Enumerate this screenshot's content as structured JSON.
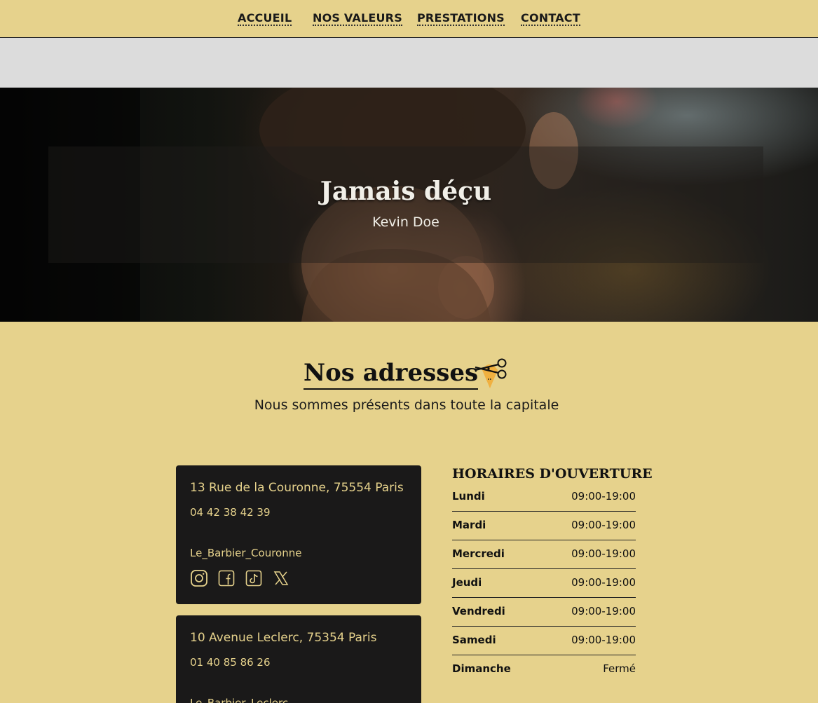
{
  "nav": {
    "items": [
      {
        "label": "ACCUEIL"
      },
      {
        "label": "NOS VALEURS"
      },
      {
        "label": "PRESTATIONS"
      },
      {
        "label": "CONTACT"
      }
    ]
  },
  "hero": {
    "quote": "Jamais déçu",
    "author": "Kevin Doe"
  },
  "addresses": {
    "title": "Nos adresses",
    "subtitle": "Nous sommes présents dans toute la capitale",
    "icon": "scissors-location-pin-icon",
    "cards": [
      {
        "address": "13 Rue de la Couronne, 75554 Paris",
        "phone": "04 42 38 42 39",
        "handle": "Le_Barbier_Couronne",
        "socials": [
          "instagram-icon",
          "facebook-icon",
          "tiktok-icon",
          "x-icon"
        ]
      },
      {
        "address": "10 Avenue Leclerc, 75354 Paris",
        "phone": "01 40 85 86 26",
        "handle": "Le_Barbier_Leclerc"
      }
    ]
  },
  "hours": {
    "title": "HORAIRES D'OUVERTURE",
    "rows": [
      {
        "day": "Lundi",
        "time": "09:00-19:00"
      },
      {
        "day": "Mardi",
        "time": "09:00-19:00"
      },
      {
        "day": "Mercredi",
        "time": "09:00-19:00"
      },
      {
        "day": "Jeudi",
        "time": "09:00-19:00"
      },
      {
        "day": "Vendredi",
        "time": "09:00-19:00"
      },
      {
        "day": "Samedi",
        "time": "09:00-19:00"
      },
      {
        "day": "Dimanche",
        "time": "Fermé"
      }
    ]
  },
  "colors": {
    "background": "#e6d28c",
    "card": "#1a1919",
    "band": "#dcdcdc",
    "text": "#1a1a1a"
  }
}
